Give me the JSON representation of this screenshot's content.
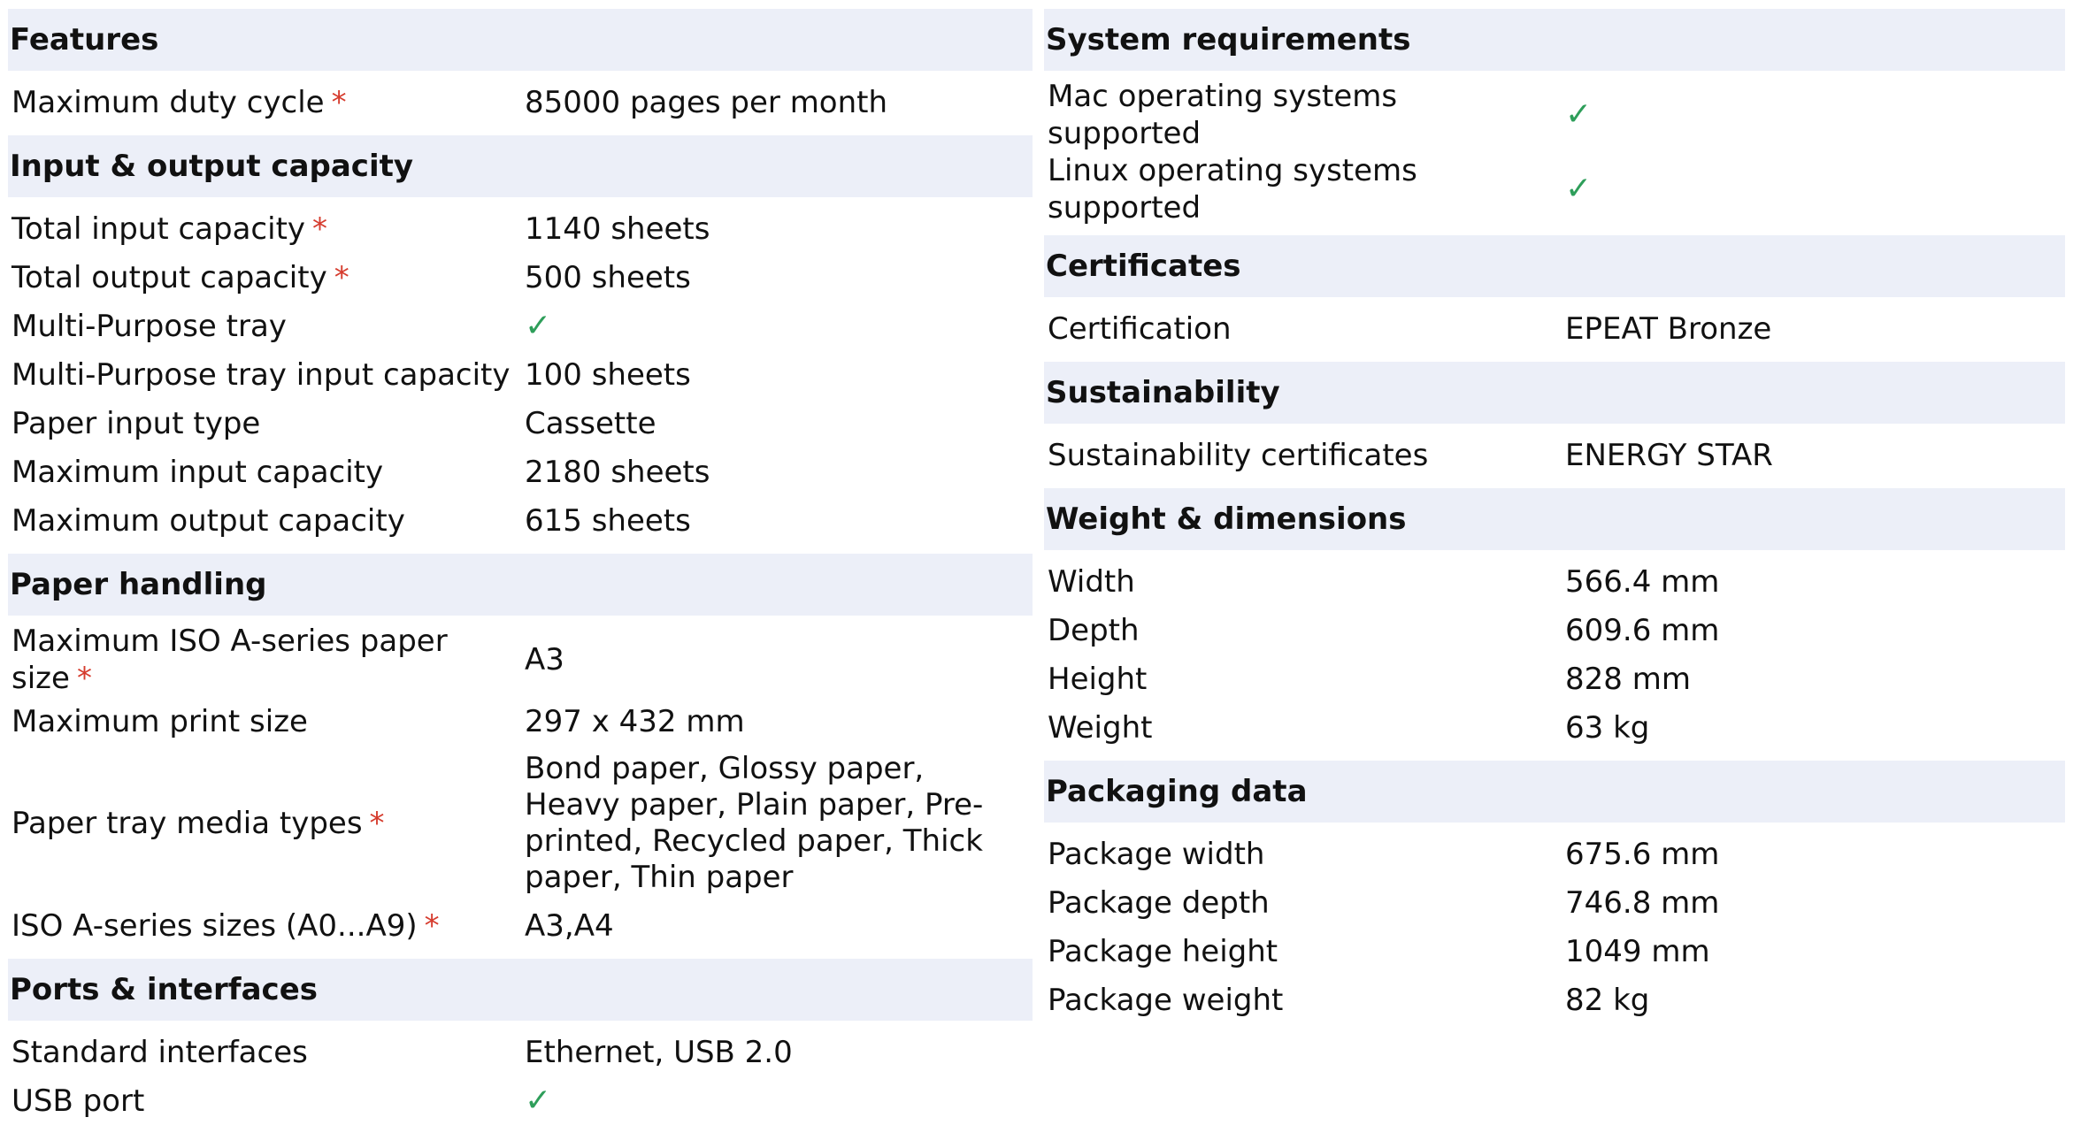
{
  "left_column": {
    "features": {
      "title": "Features",
      "rows": [
        {
          "label": "Maximum duty cycle",
          "required": "*",
          "value": "85000 pages per month"
        }
      ]
    },
    "input_output": {
      "title": "Input & output capacity",
      "rows": [
        {
          "label": "Total input capacity",
          "required": "*",
          "value": "1140 sheets"
        },
        {
          "label": "Total output capacity",
          "required": "*",
          "value": "500 sheets"
        },
        {
          "label": "Multi-Purpose tray",
          "check": "✓"
        },
        {
          "label": "Multi-Purpose tray input capacity",
          "value": "100 sheets"
        },
        {
          "label": "Paper input type",
          "value": "Cassette"
        },
        {
          "label": "Maximum input capacity",
          "value": "2180 sheets"
        },
        {
          "label": "Maximum output capacity",
          "value": "615 sheets"
        }
      ]
    },
    "paper_handling": {
      "title": "Paper handling",
      "rows": [
        {
          "label": "Maximum ISO A-series paper size",
          "required": "*",
          "value": "A3"
        },
        {
          "label": "Maximum print size",
          "value": "297 x 432 mm"
        },
        {
          "label": "Paper tray media types",
          "required": "*",
          "value": "Bond paper, Glossy paper, Heavy paper, Plain paper, Pre-printed, Recycled paper, Thick paper, Thin paper"
        },
        {
          "label": "ISO A-series sizes (A0...A9)",
          "required": "*",
          "value": "A3,A4"
        }
      ]
    },
    "ports": {
      "title": "Ports & interfaces",
      "rows": [
        {
          "label": "Standard interfaces",
          "value": "Ethernet, USB 2.0"
        },
        {
          "label": "USB port",
          "check": "✓"
        }
      ]
    }
  },
  "right_column": {
    "system_requirements": {
      "title": "System requirements",
      "rows": [
        {
          "label": "Mac operating systems supported",
          "check": "✓"
        },
        {
          "label": "Linux operating systems supported",
          "check": "✓"
        }
      ]
    },
    "certificates": {
      "title": "Certificates",
      "rows": [
        {
          "label": "Certification",
          "value": "EPEAT Bronze"
        }
      ]
    },
    "sustainability": {
      "title": "Sustainability",
      "rows": [
        {
          "label": "Sustainability certificates",
          "value": "ENERGY STAR"
        }
      ]
    },
    "weight_dimensions": {
      "title": "Weight & dimensions",
      "rows": [
        {
          "label": "Width",
          "value": "566.4 mm"
        },
        {
          "label": "Depth",
          "value": "609.6 mm"
        },
        {
          "label": "Height",
          "value": "828 mm"
        },
        {
          "label": "Weight",
          "value": "63 kg"
        }
      ]
    },
    "packaging": {
      "title": "Packaging data",
      "rows": [
        {
          "label": "Package width",
          "value": "675.6 mm"
        },
        {
          "label": "Package depth",
          "value": "746.8 mm"
        },
        {
          "label": "Package height",
          "value": "1049 mm"
        },
        {
          "label": "Package weight",
          "value": "82 kg"
        }
      ]
    }
  },
  "colors": {
    "header_bg": "#eceff8",
    "required": "#d63c2e",
    "check": "#2e9e5a"
  }
}
